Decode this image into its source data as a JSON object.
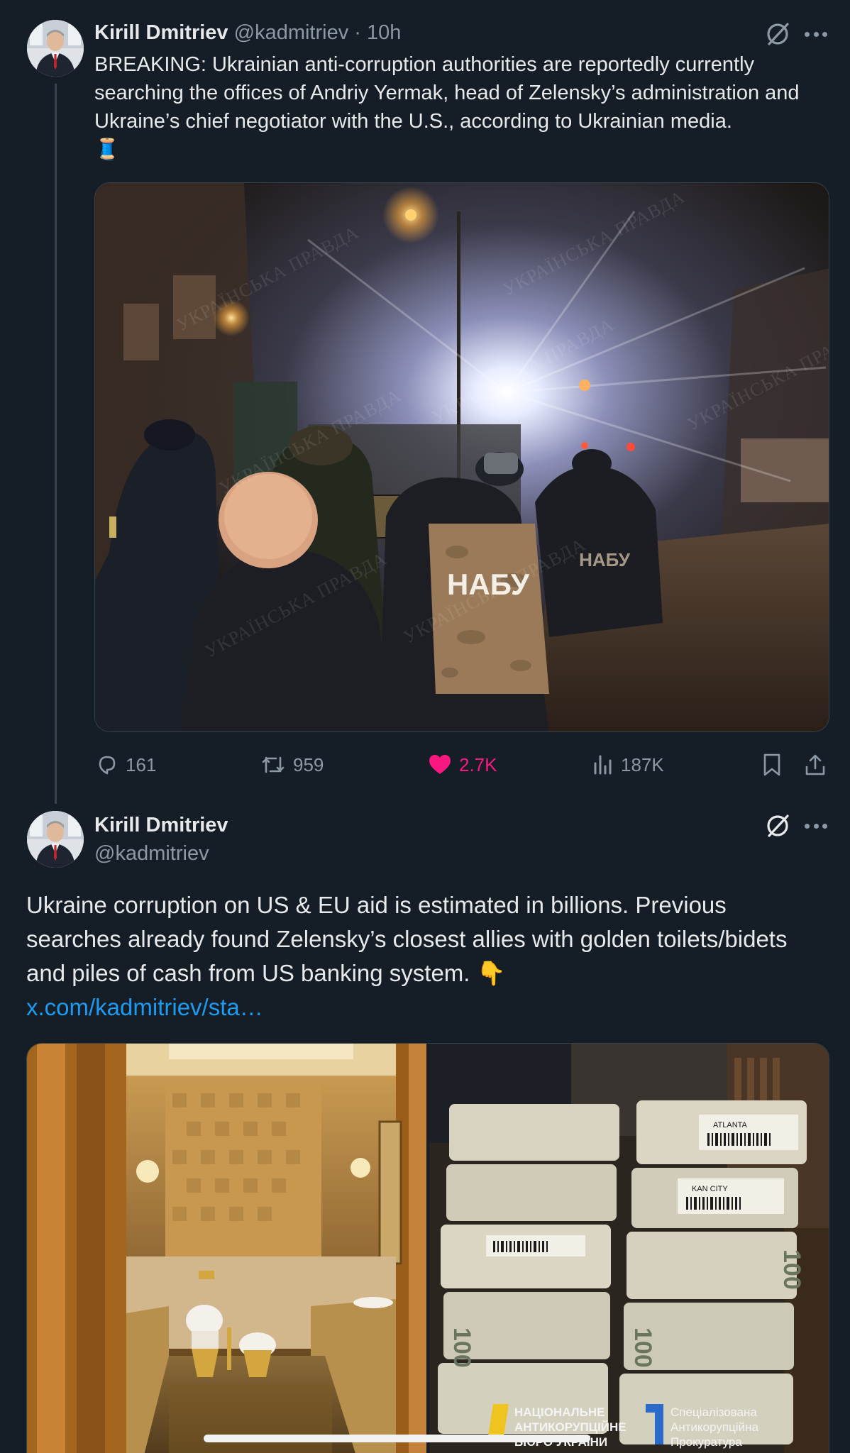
{
  "tweet1": {
    "author_name": "Kirill Dmitriev",
    "handle": "@kadmitriev",
    "separator": "·",
    "time": "10h",
    "text": "BREAKING: Ukrainian anti-corruption authorities are reportedly currently searching the offices of Andriy Yermak, head of Zelensky’s administration and Ukraine’s chief negotiator with the U.S., according to Ukrainian media.",
    "emoji": "🧵",
    "image": {
      "vest_label": "НАБУ",
      "vest_label_2": "НАБУ",
      "watermark": "УКРАЇНСЬКА ПРАВДА"
    },
    "stats": {
      "replies": "161",
      "reposts": "959",
      "likes": "2.7K",
      "views": "187K"
    }
  },
  "tweet2": {
    "author_name": "Kirill Dmitriev",
    "handle": "@kadmitriev",
    "text": "Ukraine corruption on US & EU aid is estimated in billions. Previous searches already found Zelensky’s closest allies with golden toilets/bidets and piles of cash from US banking system.",
    "emoji": "👇",
    "link": "x.com/kadmitriev/sta…",
    "image_right": {
      "logo1_line1": "НАЦІОНАЛЬНЕ",
      "logo1_line2": "АНТИКОРУПЦІЙНЕ",
      "logo1_line3": "БЮРО УКРАЇНИ",
      "logo2_line1": "Спеціалізована",
      "logo2_line2": "Антикорупційна",
      "logo2_line3": "Прокуратура",
      "band_label_1": "ATLANTA",
      "band_label_2": "KAN CITY",
      "band_100": "100"
    }
  },
  "colors": {
    "background": "#151d26",
    "text": "#e7e9ea",
    "secondary": "#8b98a5",
    "link": "#1d9bf0",
    "like": "#f91880"
  },
  "icons": {
    "grok": "grok-icon",
    "more": "more-icon",
    "reply": "reply-icon",
    "repost": "repost-icon",
    "like": "heart-icon",
    "views": "views-icon",
    "bookmark": "bookmark-icon",
    "share": "share-icon"
  }
}
